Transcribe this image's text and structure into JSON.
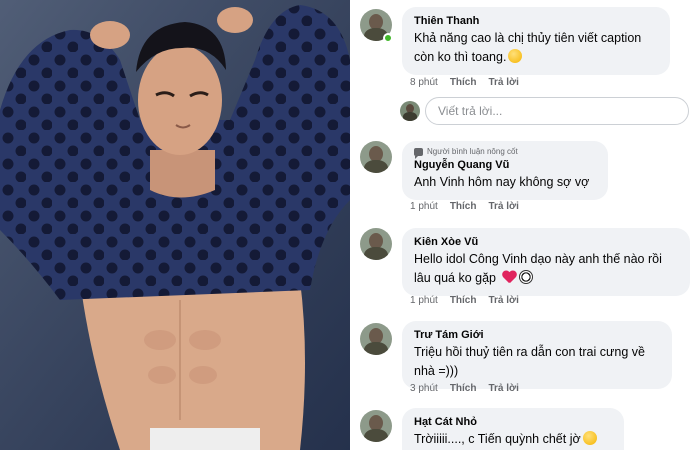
{
  "photo": {
    "alt": ""
  },
  "comments": [
    {
      "author": "Thiên Thanh",
      "badge": "",
      "text": "Khả năng cao là chị thủy tiên viết caption còn ko thì toang.",
      "emoji": "smile",
      "time": "8 phút",
      "like": "Thích",
      "reply": "Trả lời",
      "online": true
    },
    {
      "author": "Nguyễn Quang Vũ",
      "badge": "Người bình luận nông cốt",
      "text": "Anh Vinh hôm nay không sợ vợ",
      "emoji": "",
      "time": "1 phút",
      "like": "Thích",
      "reply": "Trả lời",
      "online": false
    },
    {
      "author": "Kiên Xòe Vũ",
      "badge": "",
      "text": "Hello idol Công Vinh dạo này anh thế nào rồi lâu quá ko gặp",
      "emoji": "heart-ball",
      "time": "1 phút",
      "like": "Thích",
      "reply": "Trả lời",
      "online": false
    },
    {
      "author": "Trư Tám Giới",
      "badge": "",
      "text": "Triệu hồi thuỷ tiên ra dẫn con trai cưng về nhà =)))",
      "emoji": "",
      "time": "3 phút",
      "like": "Thích",
      "reply": "Trả lời",
      "online": false
    },
    {
      "author": "Hạt Cát Nhỏ",
      "badge": "",
      "text": "Trờiiiii...., c Tiến quỳnh chết jờ",
      "emoji": "smile",
      "time": "",
      "like": "",
      "reply": "",
      "online": false
    }
  ],
  "reply_box": {
    "placeholder": "Viết trả lời..."
  },
  "colors": {
    "bubble": "#f0f2f5",
    "meta": "#65676b",
    "online": "#42b72a"
  }
}
